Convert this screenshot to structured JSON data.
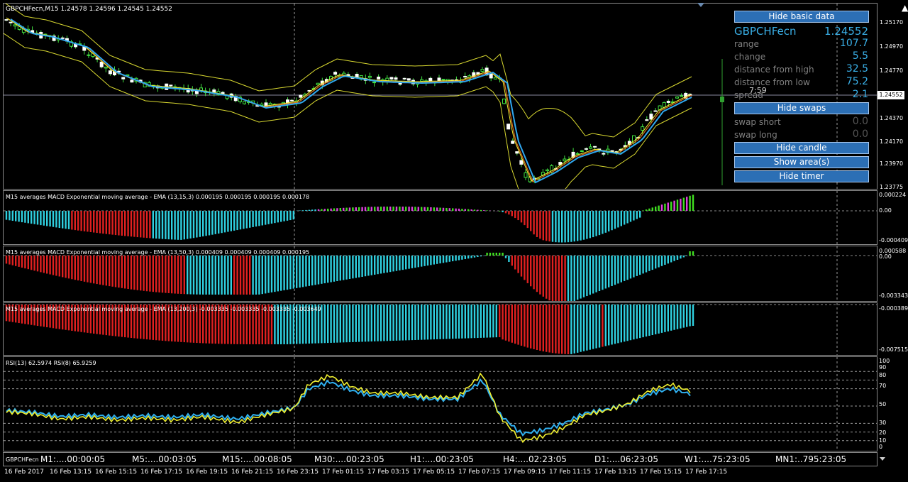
{
  "main": {
    "title": "GBPCHFecn,M15  1.24578 1.24596 1.24545 1.24552",
    "ticks": [
      "1.25170",
      "1.24970",
      "1.24770",
      "1.24552",
      "1.24370",
      "1.24170",
      "1.23970",
      "1.23775"
    ],
    "current_price": "1.24552",
    "timer": "7:59"
  },
  "info_panel": {
    "hide_basic_data": "Hide basic data",
    "symbol": "GBPCHFecn",
    "symbol_price": "1.24552",
    "rows": [
      {
        "label": "range",
        "value": "107.7"
      },
      {
        "label": "change",
        "value": "5.5"
      },
      {
        "label": "distance from high",
        "value": "32.5"
      },
      {
        "label": "distance from low",
        "value": "75.2"
      },
      {
        "label": "spread",
        "value": "2.1"
      }
    ],
    "hide_swaps": "Hide swaps",
    "swaps": [
      {
        "label": "swap short",
        "value": "0.0"
      },
      {
        "label": "swap long",
        "value": "0.0"
      }
    ],
    "hide_candle": "Hide candle",
    "show_areas": "Show area(s)",
    "hide_timer": "Hide timer"
  },
  "macd1": {
    "title": "M15 averages MACD Exponential moving average - EMA (13,15,3) 0.000195 0.000195 0.000195 0.000178",
    "ticks": [
      "0.000224",
      "0.00",
      "-0.000409"
    ]
  },
  "macd2": {
    "title": "M15 averages MACD Exponential moving average - EMA (13,50,3) 0.000409 0.000409 0.000409 0.000195",
    "ticks": [
      "0.000588",
      "0.00",
      "-0.003343"
    ]
  },
  "macd3": {
    "title": "M15 averages MACD Exponential moving average - EMA (13,200,3) -0.003335 -0.003335 -0.003335 -0.003649",
    "ticks": [
      "-0.000389",
      "-0.007515"
    ]
  },
  "rsi": {
    "title": "RSI(13) 62.5974  RSI(8) 65.9259",
    "ticks": [
      "100",
      "90",
      "80",
      "70",
      "50",
      "30",
      "20",
      "10",
      "0"
    ]
  },
  "timers_bar": {
    "symbol": "GBPCHFecn",
    "items": [
      "M1:....00:00:05",
      "M5:....00:03:05",
      "M15:....00:08:05",
      "M30:....00:23:05",
      "H1:....00:23:05",
      "H4:....02:23:05",
      "D1:....06:23:05",
      "W1:....75:23:05",
      "MN1:..795:23:05"
    ]
  },
  "dates": [
    "16 Feb 2017",
    "16 Feb 13:15",
    "16 Feb 15:15",
    "16 Feb 17:15",
    "16 Feb 19:15",
    "16 Feb 21:15",
    "16 Feb 23:15",
    "17 Feb 01:15",
    "17 Feb 03:15",
    "17 Feb 05:15",
    "17 Feb 07:15",
    "17 Feb 09:15",
    "17 Feb 11:15",
    "17 Feb 13:15",
    "17 Feb 15:15",
    "17 Feb 17:15"
  ],
  "colors": {
    "up": "#2fd0e0",
    "down": "#e02020",
    "green": "#40e020",
    "magenta": "#e040e0",
    "yellow": "#f0f030",
    "rsi_blue": "#30b0f0",
    "button": "#2c6fb5",
    "value": "#3ab0e8"
  }
}
